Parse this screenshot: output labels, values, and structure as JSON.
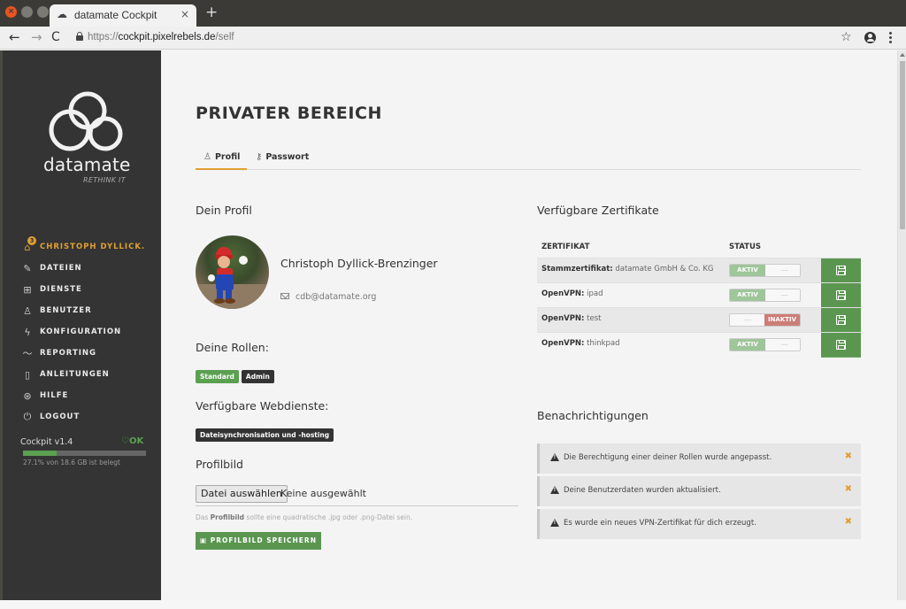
{
  "browser": {
    "tab_title": "datamate Cockpit",
    "tab_close": "×",
    "new_tab": "+",
    "url_scheme": "https://",
    "url_host": "cockpit.pixelrebels.de",
    "url_path": "/self"
  },
  "sidebar": {
    "brand": "datamate",
    "tagline": "RETHINK IT",
    "items": [
      {
        "label": "CHRISTOPH DYLLICK.",
        "icon": "home-icon",
        "badge": "3",
        "active": true
      },
      {
        "label": "DATEIEN",
        "icon": "edit-icon"
      },
      {
        "label": "DIENSTE",
        "icon": "grid-icon"
      },
      {
        "label": "BENUTZER",
        "icon": "users-icon"
      },
      {
        "label": "KONFIGURATION",
        "icon": "bolt-icon"
      },
      {
        "label": "REPORTING",
        "icon": "trend-icon"
      },
      {
        "label": "ANLEITUNGEN",
        "icon": "book-icon"
      },
      {
        "label": "HILFE",
        "icon": "lifebuoy-icon"
      },
      {
        "label": "LOGOUT",
        "icon": "power-icon"
      }
    ],
    "version": "Cockpit v1.4",
    "status": "OK",
    "storage_used_fraction": 0.271,
    "storage_text": "27.1% von 18.6 GB ist belegt"
  },
  "main": {
    "page_title": "PRIVATER BEREICH",
    "tabs": [
      {
        "label": "Profil",
        "active": true
      },
      {
        "label": "Passwort",
        "active": false
      }
    ],
    "profile": {
      "heading": "Dein Profil",
      "name": "Christoph Dyllick-Brenzinger",
      "email": "cdb@datamate.org"
    },
    "roles": {
      "heading": "Deine Rollen:",
      "items": [
        {
          "label": "Standard",
          "color": "#5aa050"
        },
        {
          "label": "Admin",
          "color": "#333333"
        }
      ]
    },
    "webservices": {
      "heading": "Verfügbare Webdienste:",
      "items": [
        "Dateisynchronisation und -hosting"
      ]
    },
    "profile_picture": {
      "heading": "Profilbild",
      "file_button": "Datei auswählen",
      "file_status": "Keine ausgewählt",
      "hint_prefix": "Das ",
      "hint_bold": "Profilbild",
      "hint_suffix": " sollte eine quadratische .jpg oder .png-Datei sein.",
      "save_button": "PROFILBILD SPEICHERN"
    },
    "certificates": {
      "heading": "Verfügbare Zertifikate",
      "columns": [
        "ZERTIFIKAT",
        "STATUS"
      ],
      "rows": [
        {
          "type": "Stammzertifikat:",
          "name": "datamate GmbH & Co. KG",
          "status": "AKTIV",
          "active": true
        },
        {
          "type": "OpenVPN:",
          "name": "ipad",
          "status": "AKTIV",
          "active": true
        },
        {
          "type": "OpenVPN:",
          "name": "test",
          "status": "INAKTIV",
          "active": false
        },
        {
          "type": "OpenVPN:",
          "name": "thinkpad",
          "status": "AKTIV",
          "active": true
        }
      ]
    },
    "notifications": {
      "heading": "Benachrichtigungen",
      "items": [
        "Die Berechtigung einer deiner Rollen wurde angepasst.",
        "Deine Benutzerdaten wurden aktualisiert.",
        "Es wurde ein neues VPN-Zertifikat für dich erzeugt."
      ]
    }
  },
  "colors": {
    "accent": "#e0a032",
    "success": "#5b9650",
    "danger": "#cc7d78",
    "sidebar_bg": "#343434"
  }
}
